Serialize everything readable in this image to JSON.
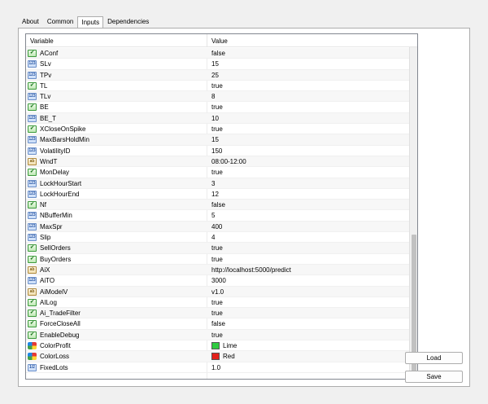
{
  "tabs": [
    {
      "label": "About"
    },
    {
      "label": "Common"
    },
    {
      "label": "Inputs",
      "active": true
    },
    {
      "label": "Dependencies"
    }
  ],
  "grid": {
    "header": {
      "variable": "Variable",
      "value": "Value"
    },
    "rows": [
      {
        "type": "bool",
        "name": "AConf",
        "value": "false"
      },
      {
        "type": "int",
        "name": "SLv",
        "value": "15"
      },
      {
        "type": "int",
        "name": "TPv",
        "value": "25"
      },
      {
        "type": "bool",
        "name": "TL",
        "value": "true"
      },
      {
        "type": "int",
        "name": "TLv",
        "value": "8"
      },
      {
        "type": "bool",
        "name": "BE",
        "value": "true"
      },
      {
        "type": "int",
        "name": "BE_T",
        "value": "10"
      },
      {
        "type": "bool",
        "name": "XCloseOnSpike",
        "value": "true"
      },
      {
        "type": "int",
        "name": "MaxBarsHoldMin",
        "value": "15"
      },
      {
        "type": "int",
        "name": "VolatilityID",
        "value": "150"
      },
      {
        "type": "str",
        "name": "WndT",
        "value": "08:00-12:00"
      },
      {
        "type": "bool",
        "name": "MonDelay",
        "value": "true"
      },
      {
        "type": "int",
        "name": "LockHourStart",
        "value": "3"
      },
      {
        "type": "int",
        "name": "LockHourEnd",
        "value": "12"
      },
      {
        "type": "bool",
        "name": "Nf",
        "value": "false"
      },
      {
        "type": "int",
        "name": "NBufferMin",
        "value": "5"
      },
      {
        "type": "int",
        "name": "MaxSpr",
        "value": "400"
      },
      {
        "type": "int",
        "name": "Slip",
        "value": "4"
      },
      {
        "type": "bool",
        "name": "SellOrders",
        "value": "true"
      },
      {
        "type": "bool",
        "name": "BuyOrders",
        "value": "true"
      },
      {
        "type": "str",
        "name": "AiX",
        "value": "http://localhost:5000/predict"
      },
      {
        "type": "int",
        "name": "AiTO",
        "value": "3000"
      },
      {
        "type": "str",
        "name": "AiModelV",
        "value": "v1.0"
      },
      {
        "type": "bool",
        "name": "AILog",
        "value": "true"
      },
      {
        "type": "bool",
        "name": "Ai_TradeFilter",
        "value": "true"
      },
      {
        "type": "bool",
        "name": "ForceCloseAll",
        "value": "false"
      },
      {
        "type": "bool",
        "name": "EnableDebug",
        "value": "true"
      },
      {
        "type": "clr",
        "name": "ColorProfit",
        "value": "Lime",
        "color": "#2ecc40"
      },
      {
        "type": "clr",
        "name": "ColorLoss",
        "value": "Red",
        "color": "#e3221c"
      },
      {
        "type": "dbl",
        "name": "FixedLots",
        "value": "1.0"
      }
    ]
  },
  "buttons": {
    "load": "Load",
    "save": "Save"
  },
  "icon_labels": {
    "int": "123",
    "dbl": "1/2",
    "str": "ab",
    "bool": "✔"
  }
}
